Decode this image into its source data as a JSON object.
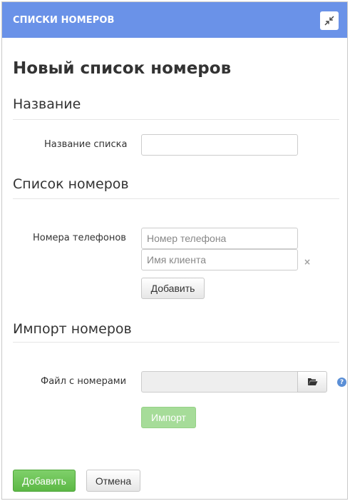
{
  "header": {
    "title": "СПИСКИ НОМЕРОВ",
    "collapse_icon": "collapse-arrows-icon"
  },
  "page": {
    "title": "Новый список номеров"
  },
  "section_name": {
    "title": "Название",
    "list_name_label": "Название списка",
    "list_name_value": "",
    "list_name_placeholder": ""
  },
  "section_numbers": {
    "title": "Список номеров",
    "phones_label": "Номера телефонов",
    "phone_placeholder": "Номер телефона",
    "client_name_placeholder": "Имя клиента",
    "remove_symbol": "×",
    "add_button": "Добавить"
  },
  "section_import": {
    "title": "Импорт номеров",
    "file_label": "Файл с номерами",
    "file_value": "",
    "folder_icon": "folder-open-icon",
    "help_icon": "question-circle-icon",
    "help_symbol": "?",
    "import_button": "Импорт"
  },
  "footer": {
    "submit_button": "Добавить",
    "cancel_button": "Отмена"
  },
  "colors": {
    "header_bg": "#6a92e8",
    "success": "#5cb845",
    "success_disabled": "#a6dc99",
    "help": "#5b8fd6"
  }
}
